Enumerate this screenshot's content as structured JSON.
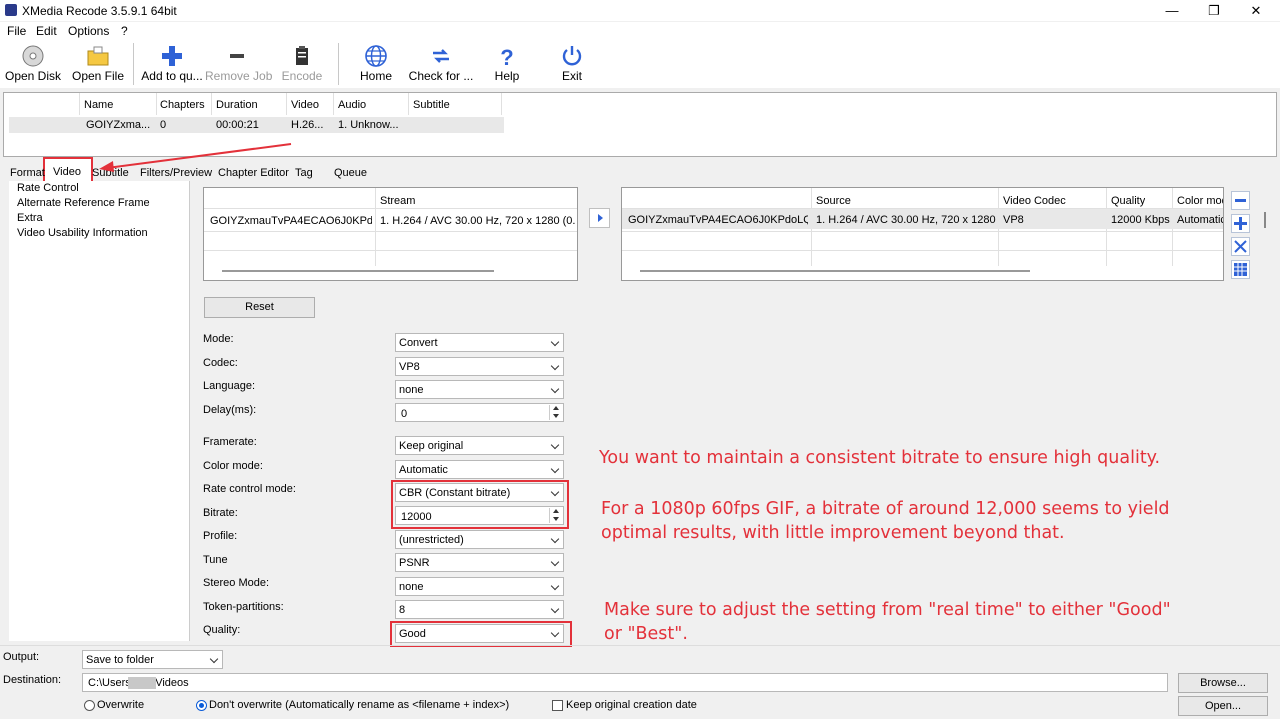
{
  "window": {
    "title": "XMedia Recode 3.5.9.1 64bit",
    "minimize": "—",
    "maximize": "❐",
    "close": "✕"
  },
  "menu": [
    "File",
    "Edit",
    "Options",
    "?"
  ],
  "toolbar": {
    "open_disk": "Open Disk",
    "open_file": "Open File",
    "add_to_queue": "Add to qu...",
    "remove_job": "Remove Job",
    "encode": "Encode",
    "home": "Home",
    "check_for": "Check for ...",
    "help": "Help",
    "exit": "Exit"
  },
  "jobs": {
    "headers": [
      "Name",
      "Chapters",
      "Duration",
      "Video",
      "Audio",
      "Subtitle"
    ],
    "row": [
      "GOIYZxma...",
      "0",
      "00:00:21",
      "H.26...",
      "1. Unknow..."
    ]
  },
  "tabs": [
    "Format",
    "Video",
    "Subtitle",
    "Filters/Preview",
    "Chapter Editor",
    "Tag",
    "Queue"
  ],
  "tree": [
    "Rate Control",
    "Alternate Reference Frame",
    "Extra",
    "Video Usability Information"
  ],
  "source_table": {
    "header_stream": "Stream",
    "name": "GOIYZxmauTvPA4ECAO6J0KPdo...",
    "stream": "1. H.264 / AVC  30.00 Hz, 720 x 1280 (0.56"
  },
  "output_table": {
    "headers": [
      "Source",
      "Video Codec",
      "Quality",
      "Color mod"
    ],
    "name": "GOIYZxmauTvPA4ECAO6J0KPdoLQo...",
    "source": "1. H.264 / AVC  30.00 Hz, 720 x 1280 (...",
    "codec": "VP8",
    "quality": "12000 Kbps",
    "color": "Automatic"
  },
  "reset_label": "Reset",
  "form": {
    "mode_label": "Mode:",
    "mode": "Convert",
    "codec_label": "Codec:",
    "codec": "VP8",
    "language_label": "Language:",
    "language": "none",
    "delay_label": "Delay(ms):",
    "delay": "0",
    "framerate_label": "Framerate:",
    "framerate": "Keep original",
    "colormode_label": "Color mode:",
    "colormode": "Automatic",
    "ratecontrol_label": "Rate control mode:",
    "ratecontrol": "CBR (Constant bitrate)",
    "bitrate_label": "Bitrate:",
    "bitrate": "12000",
    "profile_label": "Profile:",
    "profile": "(unrestricted)",
    "tune_label": "Tune",
    "tune": "PSNR",
    "stereo_label": "Stereo Mode:",
    "stereo": "none",
    "token_label": "Token-partitions:",
    "token": "8",
    "quality_label": "Quality:",
    "quality": "Good"
  },
  "annotations": {
    "a1": "You want to maintain a consistent bitrate to ensure high quality.",
    "a2_line1": "For a 1080p 60fps GIF, a bitrate of around 12,000 seems to yield",
    "a2_line2": "optimal results, with little improvement beyond that.",
    "a3_line1": "Make sure to adjust the setting from \"real time\" to either \"Good\"",
    "a3_line2": "or \"Best\"."
  },
  "bottom": {
    "output_label": "Output:",
    "output": "Save to folder",
    "destination_label": "Destination:",
    "destination": "C:\\Users\\      \\Videos",
    "browse": "Browse...",
    "open": "Open...",
    "overwrite": "Overwrite",
    "dont_overwrite": "Don't overwrite (Automatically rename as <filename + index>)",
    "keep_date": "Keep original creation date"
  },
  "colors": {
    "accent_red": "#e3313a",
    "toolbar_blue": "#2f62d6"
  }
}
